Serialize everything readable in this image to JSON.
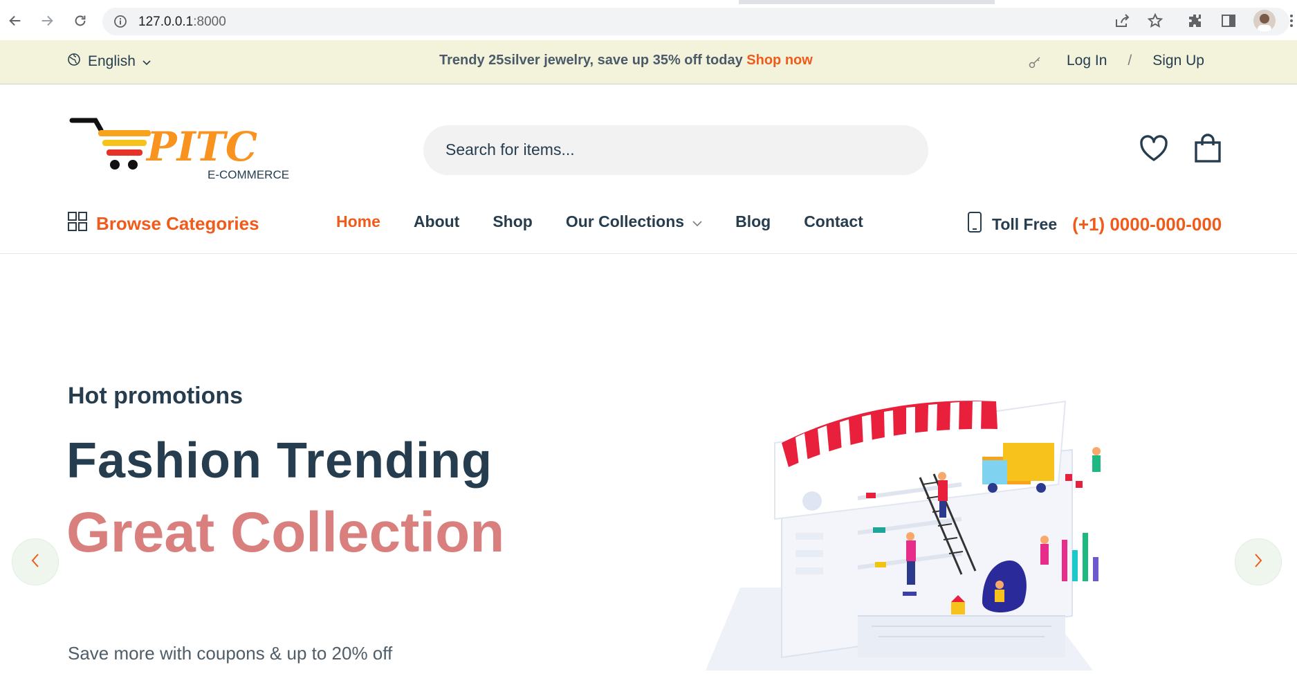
{
  "browser": {
    "url_host": "127.0.0.1",
    "url_port": ":8000"
  },
  "topbar": {
    "language": "English",
    "promo_text": "Trendy 25silver jewelry, save up 35% off today ",
    "promo_link": "Shop now",
    "login": "Log In",
    "separator": "/",
    "signup": "Sign Up"
  },
  "header": {
    "logo_text": "PITC",
    "logo_sub": "E-COMMERCE",
    "search_placeholder": "Search for items..."
  },
  "nav": {
    "browse": "Browse Categories",
    "items": [
      "Home",
      "About",
      "Shop",
      "Our Collections",
      "Blog",
      "Contact"
    ],
    "toll_label": "Toll Free",
    "toll_phone": "(+1) 0000-000-000"
  },
  "hero": {
    "subtitle": "Hot promotions",
    "title": "Fashion Trending",
    "big": "Great Collection",
    "desc": "Save more with coupons & up to 20% off"
  },
  "colors": {
    "accent": "#f05a1a",
    "topbar_bg": "#f3f3dc",
    "hero_pink": "#d9807e",
    "text_dark": "#253d4e"
  }
}
